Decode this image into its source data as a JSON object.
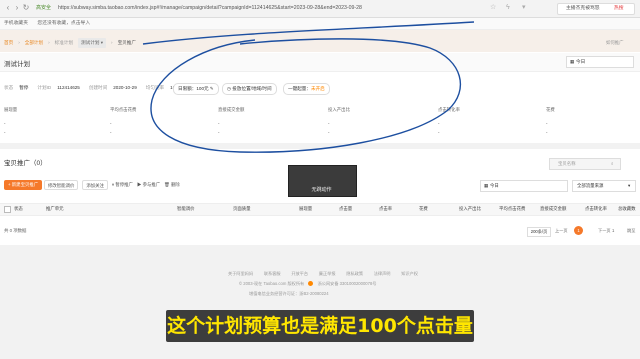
{
  "browser": {
    "secure_label": "高安全",
    "url": "https://subway.simba.taobao.com/index.jsp#!/manage/campaign/detail?campaignId=112414625&start=2023-09-28&end=2023-09-28",
    "search_placeholder": "主播杰克被骂怒",
    "search_tag": "热搜",
    "favorites_label": "手机收藏夹",
    "favorites_note": "您还没有收藏，点击导入"
  },
  "breadcrumb": {
    "home": "首页",
    "all_plans": "全部计划",
    "standard": "标准计划",
    "plan_select": "测试计划",
    "current": "宝贝推广",
    "help": "如何推广"
  },
  "plan": {
    "title": "测试计划",
    "date_range": "今日",
    "status_label": "状态",
    "status_value": "暂停",
    "id_label": "计划ID",
    "id_value": "112414625",
    "created_label": "创建时间",
    "created_value": "2020-10-29",
    "balance_label": "均匀速率",
    "balance_value": "100%",
    "budget_label": "日限额：100元",
    "location_label": "投放位置/地域/时间",
    "oneclick_label": "一键起量：",
    "oneclick_value": "未开启"
  },
  "metrics": [
    {
      "label": "展现量",
      "value": "-",
      "sub": "-"
    },
    {
      "label": "平均点击花费",
      "value": "-",
      "sub": "-"
    },
    {
      "label": "直接成交金额",
      "value": "-",
      "sub": "-"
    },
    {
      "label": "投入产出比",
      "value": "-",
      "sub": "-"
    },
    {
      "label": "点击转化率",
      "value": "-",
      "sub": "-"
    },
    {
      "label": "花费",
      "value": "-",
      "sub": "-"
    }
  ],
  "promo": {
    "section_title": "宝贝推广（0）",
    "search_placeholder": "宝贝名称",
    "overlay_text": "无跳动作",
    "add_button": "+ 新建宝贝推广",
    "toolbar": [
      "修改智能调价",
      "添加关注",
      "暂停推广",
      "参与推广",
      "删除"
    ],
    "date_select": "今日",
    "flow_select": "全部流量来源"
  },
  "table": {
    "headers": [
      "状态",
      "推广单元",
      "智能调价",
      "页面质量",
      "展现量",
      "点击量",
      "点击率",
      "花费",
      "投入产出比",
      "平均点击花费",
      "直接成交金额",
      "点击转化率",
      "总收藏数"
    ],
    "empty_note": "共 0 项数据",
    "page_size": "200条/页",
    "pages": [
      "1"
    ],
    "page_prev": "上一页",
    "page_next": "下一页",
    "page_goto": "1",
    "page_goto_label": "跳至"
  },
  "footer": {
    "links": [
      "关于阿里妈妈",
      "联系客服",
      "开放平台",
      "廉正举报",
      "隐私政策",
      "法律声明",
      "知识产权"
    ],
    "copyright": "© 2003-现在 Taobao.com 版权所有",
    "icp": "浙公网安备 33010002000078号",
    "license": "增值电信业务经营许可证：浙B2-20080224"
  },
  "subtitle": "这个计划预算也是满足100个点击量",
  "colors": {
    "accent": "#f5792a",
    "ink": "#1d4fa0",
    "subtitle": "#ffe600"
  }
}
